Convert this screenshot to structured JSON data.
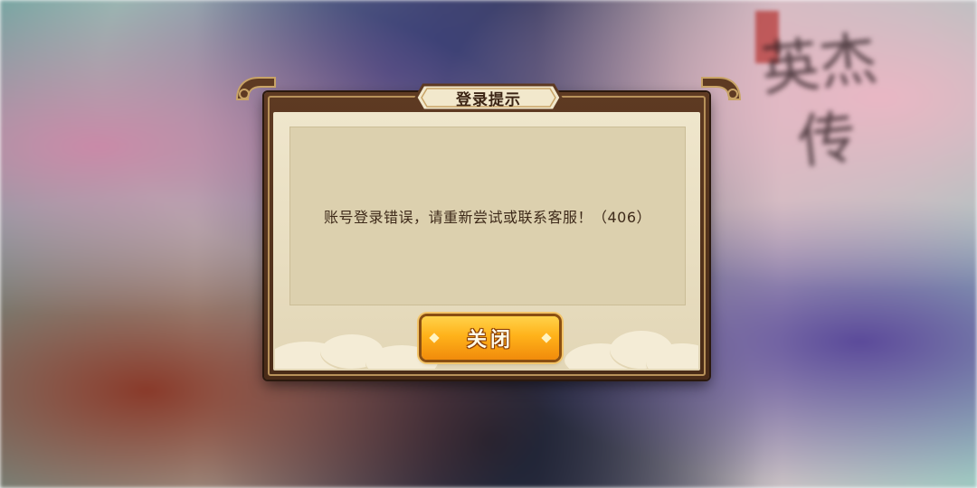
{
  "background": {
    "title_art": "英杰传"
  },
  "dialog": {
    "title": "登录提示",
    "message": "账号登录错误，请重新尝试或联系客服！（406）",
    "close_button_label": "关闭"
  },
  "colors": {
    "frame": "#4a2c18",
    "parchment": "#e6dbbd",
    "button_top": "#ffd24a",
    "button_bottom": "#f18b0b"
  },
  "icons": [
    "left-corner-ornament-icon",
    "right-corner-ornament-icon",
    "diamond-icon"
  ]
}
